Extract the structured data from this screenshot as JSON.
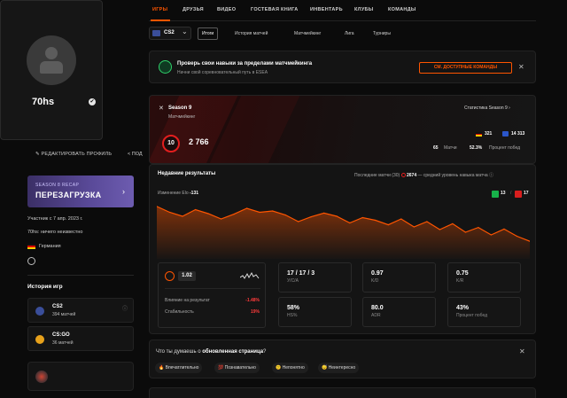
{
  "profile": {
    "nickname": "70hs",
    "verified_icon": "✔",
    "edit_label": "РЕДАКТИРОВАТЬ ПРОФИЛЬ",
    "share_label": "ПОД",
    "member_since": "Участник с 7 апр. 2023 г.",
    "bio": "70hs: ничего неизвестно",
    "country": "Германия"
  },
  "banner": {
    "small": "SEASON 8 RECAP",
    "big": "ПЕРЕЗАГРУЗКА",
    "arrow": "›"
  },
  "game_history": {
    "title": "История игр",
    "items": [
      {
        "name": "CS2",
        "sub": "394 матчей",
        "icon_color": "#3a4e9a",
        "info": "ⓘ"
      },
      {
        "name": "CS:GO",
        "sub": "36 матчей",
        "icon_color": "#e7a11b"
      }
    ]
  },
  "topnav": {
    "items": [
      "ИГРЫ",
      "ДРУЗЬЯ",
      "ВИДЕО",
      "ГОСТЕВАЯ КНИГА",
      "ИНВЕНТАРЬ",
      "КЛУБЫ",
      "КОМАНДЫ"
    ],
    "active": "ИГРЫ"
  },
  "game_select": {
    "value": "CS2",
    "chevron": "⌄"
  },
  "subtabs": {
    "items": [
      "Итоги",
      "История матчей",
      "Матчмейкинг",
      "Лига",
      "Турниры"
    ],
    "active": "Итоги"
  },
  "promo": {
    "title": "Проверь свои навыки за пределами матчмейкинга",
    "subtitle": "Начни свой соревновательный путь в ESEA",
    "button": "СМ. ДОСТУПНЫЕ КОМАНДЫ",
    "close": "✕"
  },
  "season": {
    "title": "Season 9",
    "subtitle": "Матчмейкинг",
    "stats_link": "Статистика Season 9",
    "level": "10",
    "elo": "2 766",
    "elo_counts": [
      {
        "value": "321",
        "flag": "de"
      },
      {
        "value": "14 313",
        "flag": "eu"
      }
    ],
    "matches_value": "65",
    "matches_label": "Матчи",
    "winrate_value": "52.3%",
    "winrate_label": "Процент побед"
  },
  "recent": {
    "title": "Недавние результаты",
    "last_matches": "Последние матчи",
    "last_count": "(30)",
    "avg_elo": "2674",
    "avg_label": "— средний уровень навыка матча",
    "info": "ⓘ",
    "elo_change_label": "Изменение Elo",
    "elo_change_value": "-131",
    "wins": "13",
    "losses": "17",
    "divider": "/",
    "rating_value": "1.02",
    "impact_label": "Влияние на результат",
    "impact_value": "-1.48%",
    "stability_label": "Стабильность",
    "stability_value": "19%",
    "stats": [
      {
        "value": "17 / 17 / 3",
        "label": "У/С/А"
      },
      {
        "value": "0.97",
        "label": "K/D"
      },
      {
        "value": "0.75",
        "label": "K/R"
      },
      {
        "value": "58%",
        "label": "HS%"
      },
      {
        "value": "80.0",
        "label": "ADR"
      },
      {
        "value": "43%",
        "label": "Процент побед"
      }
    ]
  },
  "feedback": {
    "question_start": "Что ты думаешь о ",
    "question_bold": "обновленная страница",
    "question_end": "?",
    "close": "✕",
    "options": [
      "Впечатлительно",
      "Познавательно",
      "Непонятно",
      "Неинтересно"
    ]
  },
  "chart_data": {
    "type": "area",
    "title": "",
    "xlabel": "",
    "ylabel": "",
    "x": [
      1,
      2,
      3,
      4,
      5,
      6,
      7,
      8,
      9,
      10,
      11,
      12,
      13,
      14,
      15,
      16,
      17,
      18,
      19,
      20,
      21,
      22,
      23,
      24,
      25,
      26,
      27,
      28,
      29,
      30
    ],
    "values": [
      2897,
      2875,
      2860,
      2885,
      2870,
      2850,
      2868,
      2890,
      2875,
      2880,
      2865,
      2840,
      2858,
      2872,
      2860,
      2835,
      2855,
      2845,
      2828,
      2850,
      2820,
      2840,
      2810,
      2832,
      2800,
      2818,
      2790,
      2812,
      2785,
      2766
    ],
    "ylim": [
      2700,
      2920
    ],
    "grid": false,
    "color": "#ff5500"
  }
}
